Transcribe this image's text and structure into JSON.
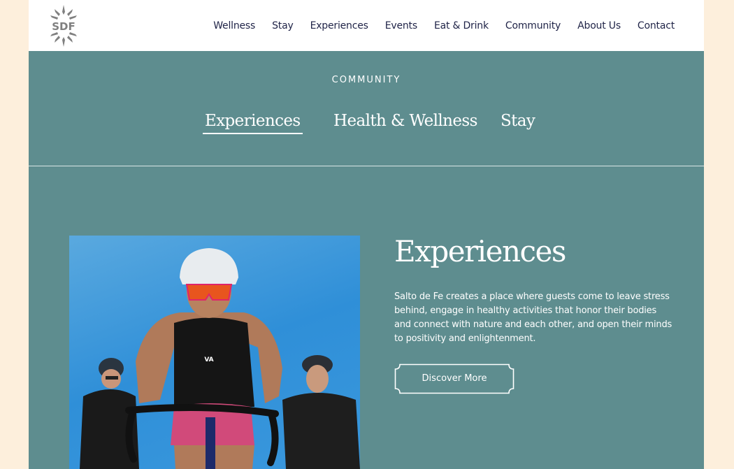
{
  "header": {
    "logo_text": "SDF",
    "nav": [
      {
        "label": "Wellness"
      },
      {
        "label": "Stay"
      },
      {
        "label": "Experiences"
      },
      {
        "label": "Events"
      },
      {
        "label": "Eat & Drink"
      },
      {
        "label": "Community"
      },
      {
        "label": "About Us"
      },
      {
        "label": "Contact"
      }
    ]
  },
  "section": {
    "eyebrow": "COMMUNITY",
    "tabs": [
      {
        "label": "Experiences",
        "active": true
      },
      {
        "label": "Health & Wellness",
        "active": false
      },
      {
        "label": "Stay",
        "active": false
      }
    ]
  },
  "content": {
    "image_alt": "Cyclists riding road bikes under a blue sky",
    "title": "Experiences",
    "body": "Salto de Fe creates a place where guests come to leave stress behind, engage in healthy activities that honor their bodies and connect with nature and each other, and open their minds to positivity and enlightenment.",
    "cta_label": "Discover More"
  },
  "colors": {
    "page_bg": "#fdefdc",
    "teal": "#5e8d8f",
    "nav_text": "#1f2347",
    "logo_gray": "#808080",
    "white": "#ffffff"
  }
}
